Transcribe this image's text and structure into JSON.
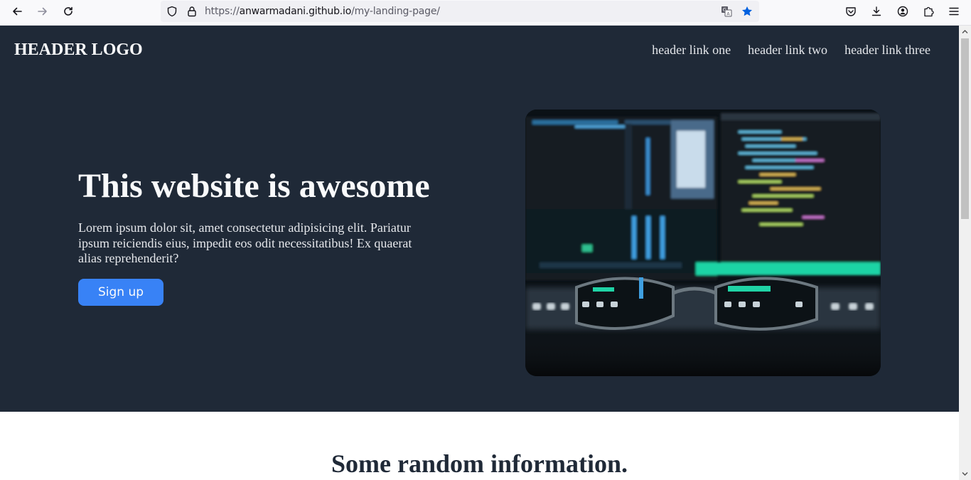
{
  "browser": {
    "url_protocol": "https://",
    "url_host": "anwarmadani.github.io",
    "url_path": "/my-landing-page/",
    "accent_color": "#0060df"
  },
  "header": {
    "logo": "HEADER LOGO",
    "links": [
      "header link one",
      "header link two",
      "header link three"
    ]
  },
  "hero": {
    "title": "This website is awesome",
    "text": "Lorem ipsum dolor sit, amet consectetur adipisicing elit. Pariatur ipsum reiciendis eius, impedit eos odit necessitatibus! Ex quaerat alias reprehenderit?",
    "button_label": "Sign up",
    "background_color": "#1f2937",
    "button_color": "#3882f6"
  },
  "info": {
    "title": "Some random information."
  }
}
